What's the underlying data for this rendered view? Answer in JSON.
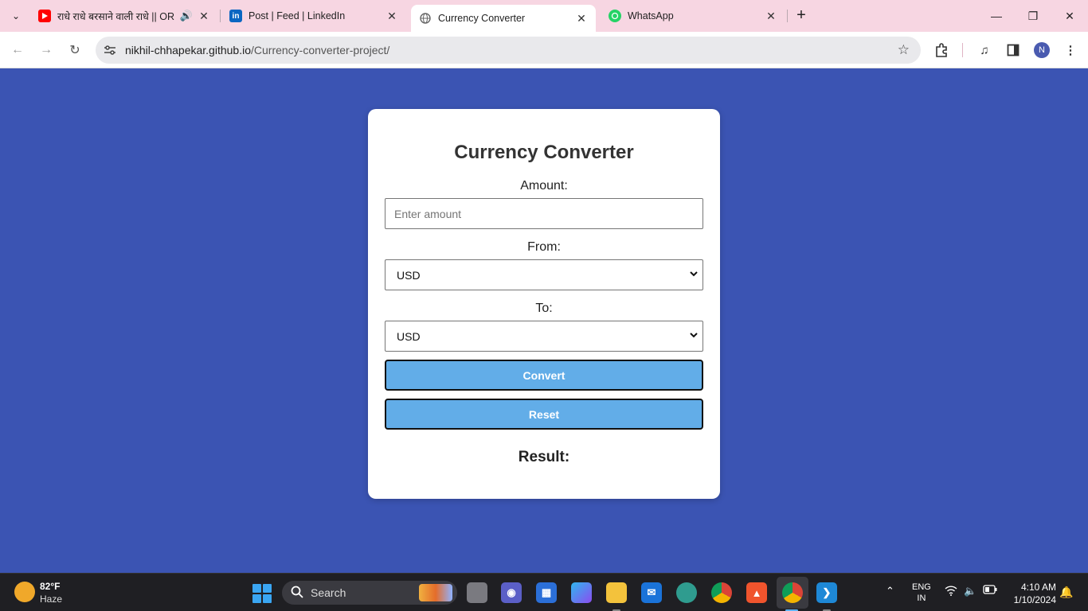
{
  "browser": {
    "tabs": [
      {
        "title": "राधे राधे बरसाने वाली राधे || OR",
        "favicon": "youtube-icon",
        "audio": true
      },
      {
        "title": "Post | Feed | LinkedIn",
        "favicon": "linkedin-icon"
      },
      {
        "title": "Currency Converter",
        "favicon": "globe-icon",
        "active": true
      },
      {
        "title": "WhatsApp",
        "favicon": "whatsapp-icon"
      }
    ],
    "url_host": "nikhil-chhapekar.github.io",
    "url_path": "/Currency-converter-project/",
    "profile_initial": "N"
  },
  "page": {
    "background": "#3b54b3",
    "title": "Currency Converter",
    "amount_label": "Amount:",
    "amount_placeholder": "Enter amount",
    "from_label": "From:",
    "from_value": "USD",
    "to_label": "To:",
    "to_value": "USD",
    "convert_label": "Convert",
    "reset_label": "Reset",
    "result_label": "Result:",
    "button_color": "#62ade8"
  },
  "taskbar": {
    "weather_temp": "82°F",
    "weather_cond": "Haze",
    "search_label": "Search",
    "lang_top": "ENG",
    "lang_bottom": "IN",
    "time": "4:10 AM",
    "date": "1/10/2024",
    "apps": [
      "file-explorer-icon",
      "teams-icon",
      "store-icon",
      "copilot-icon",
      "folder-icon",
      "mail-icon",
      "edge-icon",
      "chrome-icon",
      "brave-icon",
      "chrome-profile-icon",
      "vscode-icon"
    ]
  }
}
